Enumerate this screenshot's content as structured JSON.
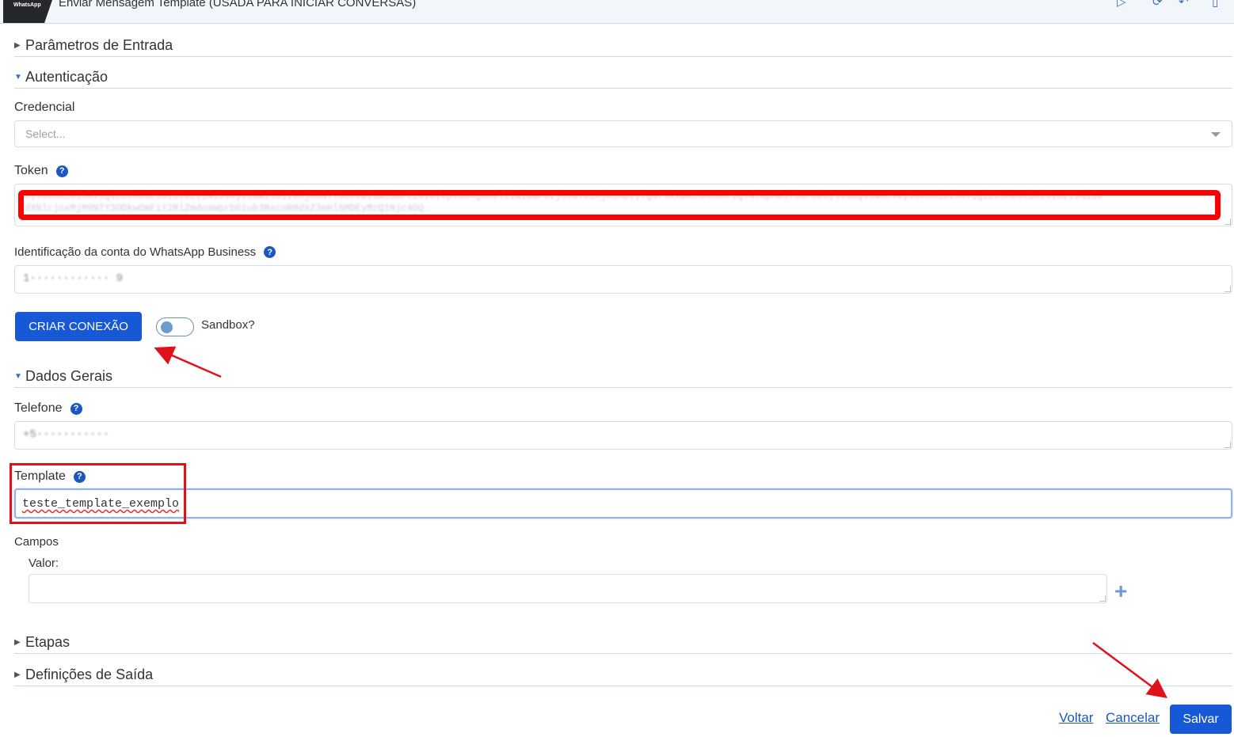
{
  "window": {
    "logo_text": "WhatsApp",
    "title": "Enviar Mensagem Template (USADA PARA INICIAR CONVERSAS)"
  },
  "sections": {
    "params": "Parâmetros de Entrada",
    "auth": "Autenticação",
    "general": "Dados Gerais",
    "steps": "Etapas",
    "output": "Definições de Saída"
  },
  "auth": {
    "credential_label": "Credencial",
    "credential_placeholder": "Select...",
    "token_label": "Token",
    "token_value": "eyJ0eXAiOiJKV1QiLCJhbGciOiJIUzI1NiJ9eyJzdWIiOiIxMjM0NTY3ODkwIiwibmFtZSI6IkpvaG4gRG9lIiwiaWF0IjoxNTE2MjM5MDIyfQSflKxwRJSMeKKF2QT4fwpMeJf36POk6yJVadQssw5cVeyJ0eXAiOiJKV1QiLCJhbGciOiJIUzI1NiJ9",
    "token_value_2": "dXNlcjoxMjM0NTY3ODkwOmFiY2RlZmdoaWprbG1ub3BxcnN0dXZ3eHl6MDEyMzQ1Njc4OQ",
    "waba_label": "Identificação da conta do WhatsApp Business",
    "waba_value": "1············ 9",
    "connect_button": "CRIAR CONEXÃO",
    "sandbox_label": "Sandbox?"
  },
  "general": {
    "phone_label": "Telefone",
    "phone_value": "+5···········",
    "template_label": "Template",
    "template_value": "teste_template_exemplo",
    "fields_label": "Campos",
    "value_label": "Valor:",
    "value_input": "",
    "add_icon": "plus-icon"
  },
  "footer": {
    "back": "Voltar",
    "cancel": "Cancelar",
    "save": "Salvar"
  },
  "colors": {
    "primary": "#1658d6",
    "annotation": "#e0111b",
    "link": "#1a56c4"
  }
}
